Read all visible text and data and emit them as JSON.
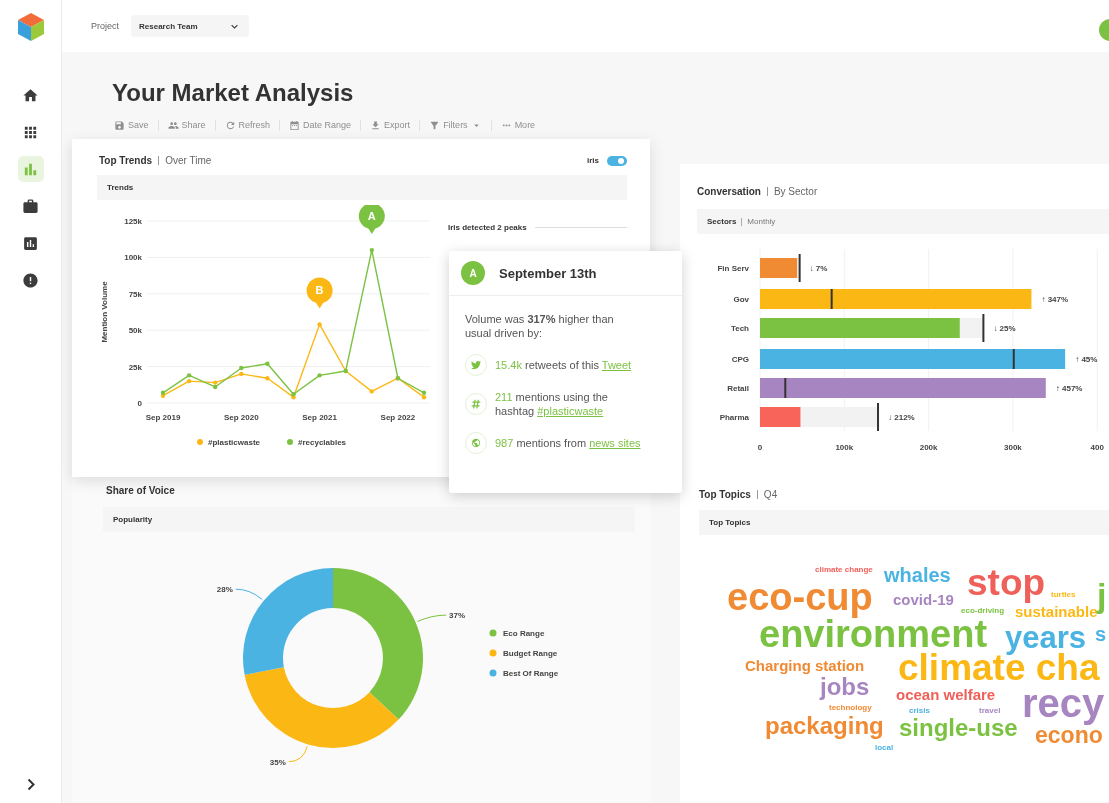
{
  "sidebar": {
    "items": [
      {
        "selected": false
      },
      {
        "selected": false
      },
      {
        "selected": true
      },
      {
        "selected": false
      },
      {
        "selected": false
      },
      {
        "selected": false
      }
    ]
  },
  "topbar": {
    "project_label": "Project",
    "project_value": "Research Team"
  },
  "page": {
    "title": "Your Market Analysis",
    "toolbar": [
      {
        "label": "Save",
        "kind": "button",
        "disabled": true
      },
      {
        "label": "Share",
        "kind": "button",
        "disabled": true
      },
      {
        "label": "Refresh",
        "kind": "button",
        "disabled": true
      },
      {
        "label": "Date Range",
        "kind": "button",
        "disabled": true
      },
      {
        "label": "Export",
        "kind": "button",
        "disabled": true
      },
      {
        "label": "Filters",
        "kind": "dropdown",
        "disabled": true
      },
      {
        "label": "More",
        "kind": "button",
        "disabled": true
      }
    ]
  },
  "top_trends": {
    "title": "Top Trends",
    "subtitle": "Over Time",
    "toggle": {
      "label": "iris",
      "on": true
    },
    "panel_title": "Trends",
    "peaks_note": "Iris detected 2 peaks",
    "chart_data": {
      "type": "line",
      "ylabel": "Mention Volume",
      "grid": true,
      "legend": "bottom",
      "categories": [
        "Sep 2019",
        null,
        null,
        "Sep 2020",
        null,
        null,
        "Sep 2021",
        null,
        null,
        "Sep 2022",
        null
      ],
      "series": [
        {
          "name": "#plasticwaste",
          "color": "#fbb814",
          "values": [
            5,
            15,
            14,
            20,
            17,
            4,
            54,
            22,
            8,
            17,
            4
          ]
        },
        {
          "name": "#recyclables",
          "color": "#7cc242",
          "values": [
            7,
            19,
            11,
            24,
            27,
            6,
            19,
            22,
            105,
            17,
            7
          ]
        }
      ],
      "ylim": [
        0,
        125
      ],
      "yticks": [
        {
          "value": 0,
          "label": "0"
        },
        {
          "value": 25,
          "label": "25k"
        },
        {
          "value": 50,
          "label": "50k"
        },
        {
          "value": 75,
          "label": "75k"
        },
        {
          "value": 100,
          "label": "100k"
        },
        {
          "value": 125,
          "label": "125k"
        }
      ],
      "annotations": [
        {
          "text": "B",
          "y": 54
        },
        {
          "text": "A",
          "y": 105
        }
      ]
    }
  },
  "tooltip": {
    "badge": "A",
    "title": "September 13th",
    "summary": "Volume was **317%** higher than usual driven by:",
    "items": [
      {
        "kind": "retweets",
        "parts": [
          {
            "kind": "accent",
            "text": "15.4k"
          },
          {
            "kind": "plain",
            "text": " retweets of this "
          },
          {
            "kind": "link",
            "text": "Tweet"
          }
        ]
      },
      {
        "kind": "hashtag",
        "parts": [
          {
            "kind": "accent",
            "text": "211"
          },
          {
            "kind": "plain",
            "text": " mentions using the hashtag "
          },
          {
            "kind": "link",
            "text": "#plasticwaste"
          }
        ]
      },
      {
        "kind": "news",
        "parts": [
          {
            "kind": "accent",
            "text": "987"
          },
          {
            "kind": "plain",
            "text": " mentions from "
          },
          {
            "kind": "link",
            "text": "news sites"
          }
        ]
      }
    ]
  },
  "conversation": {
    "title": "Conversation",
    "subtitle": "By Sector",
    "panel_title": "Sectors",
    "panel_subtitle": "Monthly",
    "chart_data": {
      "type": "bar",
      "orientation": "horizontal",
      "categories": [
        "Fin Serv",
        "Gov",
        "Tech",
        "CPG",
        "Retail",
        "Pharma"
      ],
      "values": [
        44,
        322,
        237,
        362,
        339,
        48
      ],
      "colors": [
        "#f08a33",
        "#fbb814",
        "#7cc242",
        "#4ab3e2",
        "#a785c0",
        "#f8645a"
      ],
      "annotations": [
        "↓ 7%",
        "↑ 347%",
        "↓ 25%",
        "↑ 45%",
        "↑ 457%",
        "↓ 212%"
      ],
      "grid": true,
      "xlim": [
        0,
        400
      ],
      "xticks": [
        {
          "value": 0,
          "label": "0"
        },
        {
          "value": 100,
          "label": "100k"
        },
        {
          "value": 200,
          "label": "200k"
        },
        {
          "value": 300,
          "label": "300k"
        },
        {
          "value": 400,
          "label": "400"
        }
      ]
    },
    "previous_marks": [
      {
        "level": 0.1175
      },
      {
        "level": 0.2125
      },
      {
        "level": 0.6625
      },
      {
        "level": 0.7525
      },
      {
        "level": 0.075
      },
      {
        "level": 0.35
      }
    ]
  },
  "share_of_voice": {
    "title": "Share of Voice",
    "panel_title": "Popularity",
    "chart_data": {
      "type": "donut",
      "legend": "right",
      "categories": [
        "Eco Range",
        "Budget Range",
        "Best Of Range"
      ],
      "values": [
        37,
        35,
        28
      ],
      "colors": [
        "#7cc242",
        "#fbb814",
        "#4ab3e2"
      ],
      "value_labels": [
        "37%",
        "35%",
        "28%"
      ]
    }
  },
  "top_topics": {
    "title": "Top Topics",
    "subtitle": "Q4",
    "panel_title": "Top Topics",
    "words": [
      {
        "text": "climate change",
        "color": "#f0605a"
      },
      {
        "text": "eco-cup",
        "color": "#f08a33"
      },
      {
        "text": "whales",
        "color": "#4ab3e2"
      },
      {
        "text": "covid-19",
        "color": "#a785c0"
      },
      {
        "text": "stop",
        "color": "#f0605a"
      },
      {
        "text": "turtles",
        "color": "#fbb814"
      },
      {
        "text": "eco-driving",
        "color": "#7cc242"
      },
      {
        "text": "sustainable",
        "color": "#fbb814"
      },
      {
        "text": "j",
        "color": "#7cc242"
      },
      {
        "text": "environment",
        "color": "#7cc242"
      },
      {
        "text": "years",
        "color": "#4ab3e2"
      },
      {
        "text": "s",
        "color": "#4ab3e2"
      },
      {
        "text": "Charging station",
        "color": "#f08a33"
      },
      {
        "text": "jobs",
        "color": "#a785c0"
      },
      {
        "text": "climate cha",
        "color": "#fbb814"
      },
      {
        "text": "ocean welfare",
        "color": "#f0605a"
      },
      {
        "text": "technology",
        "color": "#f08a33"
      },
      {
        "text": "crisis",
        "color": "#4ab3e2"
      },
      {
        "text": "travel",
        "color": "#a785c0"
      },
      {
        "text": "recy",
        "color": "#a785c0"
      },
      {
        "text": "packaging",
        "color": "#f08a33"
      },
      {
        "text": "local",
        "color": "#4ab3e2"
      },
      {
        "text": "single-use",
        "color": "#7cc242"
      },
      {
        "text": "econo",
        "color": "#f08a33"
      }
    ]
  }
}
